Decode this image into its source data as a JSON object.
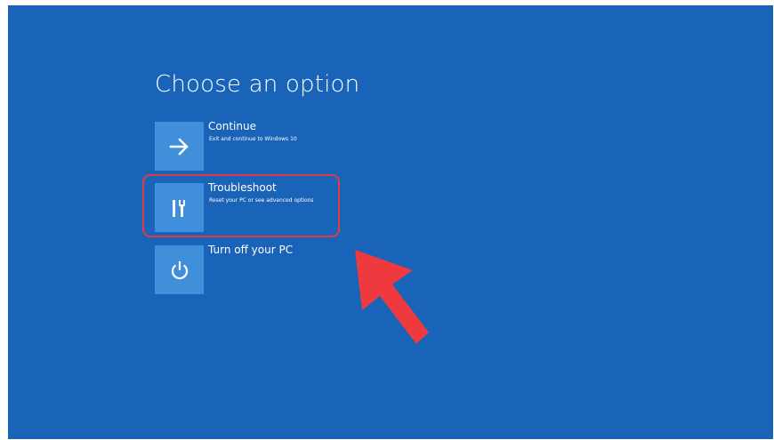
{
  "page": {
    "title": "Choose an option"
  },
  "options": [
    {
      "label": "Continue",
      "description": "Exit and continue to Windows 10",
      "icon": "arrow-right-icon"
    },
    {
      "label": "Troubleshoot",
      "description": "Reset your PC or see advanced options",
      "icon": "tools-icon"
    },
    {
      "label": "Turn off your PC",
      "description": "",
      "icon": "power-icon"
    }
  ],
  "colors": {
    "background": "#1964b8",
    "tile": "#3f8fdb",
    "highlight": "#e23b48",
    "annotation_arrow": "#ee3a3e"
  },
  "annotation": {
    "icon": "red-pointer-arrow-icon",
    "target": "Troubleshoot"
  }
}
